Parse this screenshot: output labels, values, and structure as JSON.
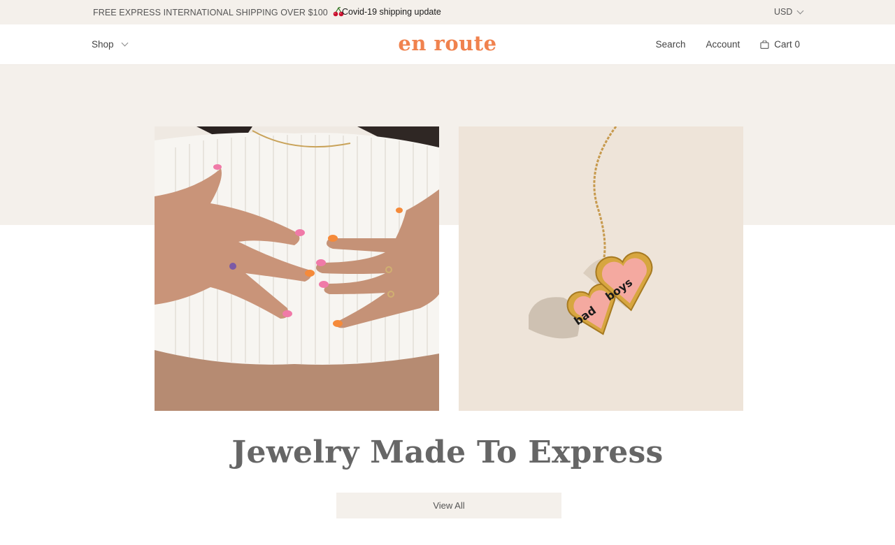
{
  "announcement": {
    "promo_text": "FREE EXPRESS INTERNATIONAL SHIPPING OVER $100",
    "promo_icon": "cherry-icon",
    "covid_link": "Covid-19 shipping update",
    "currency": "USD"
  },
  "header": {
    "shop_label": "Shop",
    "logo_text": "en route",
    "search_label": "Search",
    "account_label": "Account",
    "cart_label": "Cart 0",
    "cart_icon": "bag-icon"
  },
  "colors": {
    "brand": "#f0824e",
    "band": "#f4f0eb",
    "headline": "#666666"
  },
  "hero": {
    "headline": "Jewelry Made To Express",
    "cta_label": "View All",
    "locket_words": [
      "bad",
      "boys"
    ]
  }
}
